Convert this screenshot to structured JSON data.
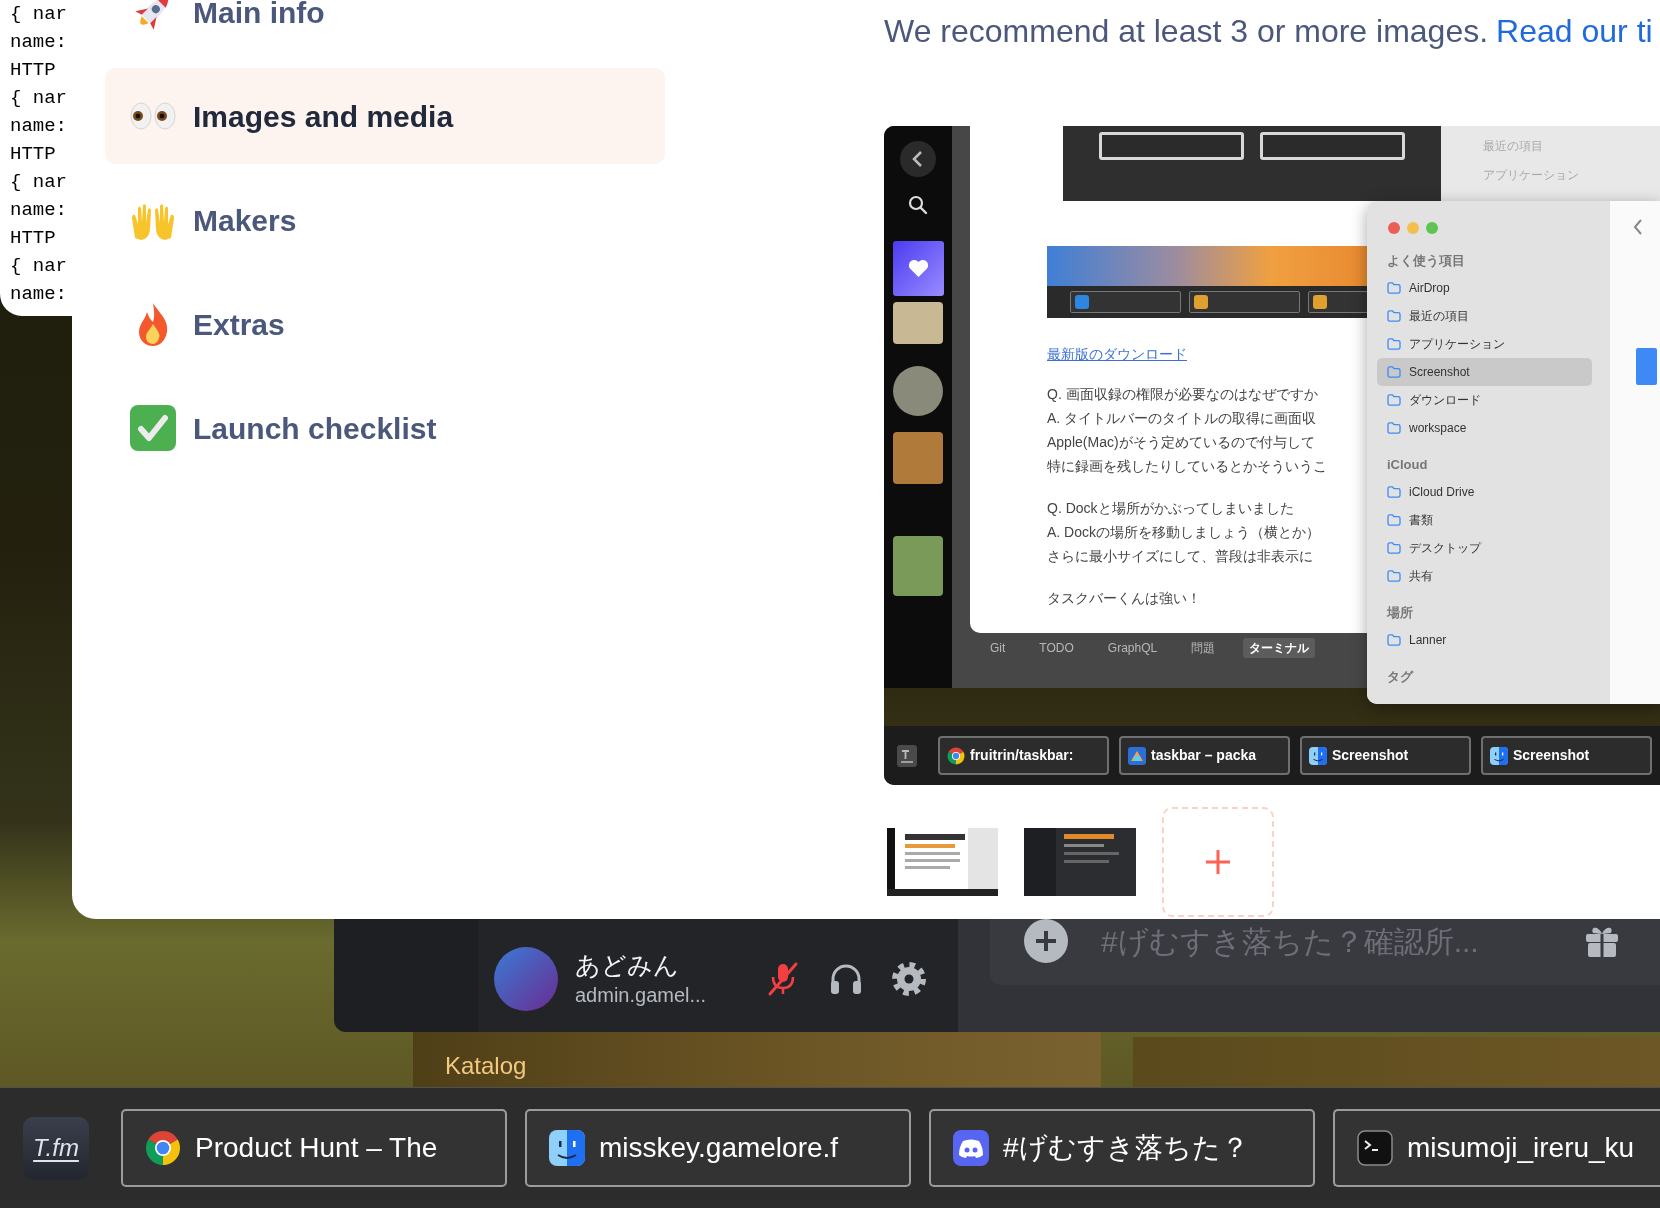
{
  "terminal": {
    "lines": [
      "{ nar",
      "name:",
      "HTTP",
      "{ nar",
      "name:",
      "HTTP",
      "{ nar",
      "name:",
      "HTTP",
      "{ nar",
      "name:"
    ]
  },
  "sidebar": {
    "items": [
      {
        "label": "Main info",
        "selected": false
      },
      {
        "label": "Images and media",
        "selected": true
      },
      {
        "label": "Makers",
        "selected": false
      },
      {
        "label": "Extras",
        "selected": false
      },
      {
        "label": "Launch checklist",
        "selected": false
      }
    ]
  },
  "media": {
    "hint": "We recommend at least 3 or more images.",
    "link": "Read our ti",
    "main_image": {
      "document": {
        "link": "最新版のダウンロード",
        "paragraphs": [
          [
            "Q. 画面収録の権限が必要なのはなぜですか",
            "A. タイトルバーのタイトルの取得に画面収",
            "Apple(Mac)がそう定めているので付与して",
            "特に録画を残したりしているとかそういうこ"
          ],
          [
            "Q. Dockと場所がかぶってしまいました",
            "A. Dockの場所を移動しましょう（横とか）",
            "さらに最小サイズにして、普段は非表示に"
          ],
          [
            "タスクバーくんは強い！"
          ]
        ]
      },
      "editor_tools": [
        {
          "label": "Git",
          "selected": false
        },
        {
          "label": "TODO",
          "selected": false
        },
        {
          "label": "GraphQL",
          "selected": false
        },
        {
          "label": "問題",
          "selected": false
        },
        {
          "label": "ターミナル",
          "selected": true
        }
      ],
      "background_finder": [
        "最近の項目",
        "アプリケーション"
      ],
      "finder_sidebar": [
        {
          "kind": "header",
          "label": "よく使う項目"
        },
        {
          "kind": "item",
          "label": "AirDrop",
          "selected": false
        },
        {
          "kind": "item",
          "label": "最近の項目",
          "selected": false
        },
        {
          "kind": "item",
          "label": "アプリケーション",
          "selected": false
        },
        {
          "kind": "item",
          "label": "Screenshot",
          "selected": true
        },
        {
          "kind": "item",
          "label": "ダウンロード",
          "selected": false
        },
        {
          "kind": "item",
          "label": "workspace",
          "selected": false
        },
        {
          "kind": "header",
          "label": "iCloud"
        },
        {
          "kind": "item",
          "label": "iCloud Drive",
          "selected": false
        },
        {
          "kind": "item",
          "label": "書類",
          "selected": false
        },
        {
          "kind": "item",
          "label": "デスクトップ",
          "selected": false
        },
        {
          "kind": "item",
          "label": "共有",
          "selected": false
        },
        {
          "kind": "header",
          "label": "場所"
        },
        {
          "kind": "item",
          "label": "Lanner",
          "selected": false
        },
        {
          "kind": "header",
          "label": "タグ"
        }
      ],
      "taskbar": [
        "fruitrin/taskbar:",
        "taskbar – packa",
        "Screenshot",
        "Screenshot"
      ]
    }
  },
  "discord": {
    "user": {
      "name": "あどみん",
      "handle": "admin.gamel..."
    },
    "mic_muted": true,
    "message_input": {
      "placeholder": "#げむすき落ちた？確認所..."
    }
  },
  "katalog": {
    "title": "Katalog"
  },
  "taskbar": {
    "logo": "T.fm",
    "items": [
      {
        "title": "Product Hunt – The"
      },
      {
        "title": "misskey.gamelore.f"
      },
      {
        "title": "#げむすき落ちた？"
      },
      {
        "title": "misumoji_ireru_ku"
      }
    ]
  }
}
